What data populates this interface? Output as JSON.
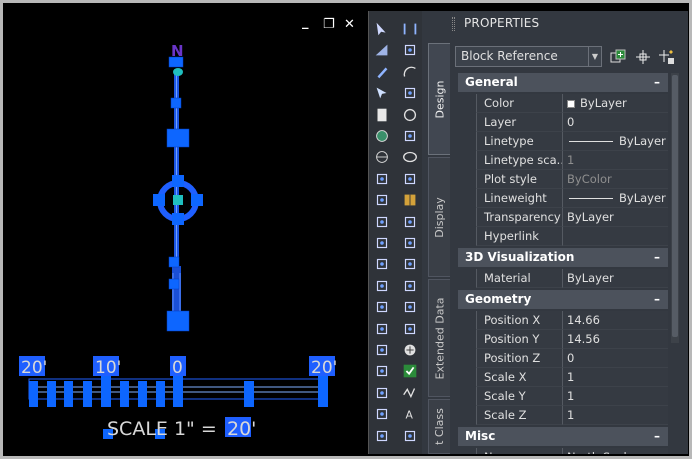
{
  "window": {
    "controls": {
      "minimize": "_",
      "restore": "❐",
      "close": "✕"
    }
  },
  "drawing": {
    "north_label": "N",
    "scale_marks": [
      "20'",
      "10'",
      "0",
      "20'"
    ],
    "scale_text": {
      "label": "SCALE 1\" = ",
      "value": "20'"
    },
    "colors": {
      "entity": "#1f5fff",
      "selection": "#2a7fe0",
      "grip": "#0d66ff",
      "label": "#d8d8d8",
      "teal": "#1fbfbf"
    }
  },
  "toolbar": {
    "column1": [
      "select-arrow-icon",
      "select-window-icon",
      "brush-icon",
      "pointer-icon",
      "page-icon",
      "globe-green-icon",
      "globe-icon",
      "snap-endpoint-icon",
      "snap-midpoint-icon",
      "snap-center-icon",
      "snap-node-icon",
      "snap-quadrant-icon",
      "snap-intersection-icon",
      "snap-extension-icon",
      "snap-insert-icon",
      "snap-perp-icon",
      "snap-tangent-icon",
      "snap-nearest-icon",
      "snap-apparent-icon",
      "snap-parallel-icon"
    ],
    "column2": [
      "line-icon",
      "polyline-icon",
      "arc-icon",
      "rect-icon",
      "circle-icon",
      "arc2-icon",
      "ellipse-icon",
      "hatch-icon",
      "table-icon",
      "dim-linear-icon",
      "dim-aligned-icon",
      "dim-angular-icon",
      "dim-baseline-icon",
      "dim-continue-icon",
      "point-icon",
      "plus-icon",
      "check-icon",
      "wave-icon",
      "text-icon",
      "mtext-icon"
    ]
  },
  "palette": {
    "title": "PROPERTIES",
    "tabs": [
      "Design",
      "Display",
      "Extended Data",
      "t Class"
    ],
    "selector": "Block Reference",
    "quick_icons": [
      "add-selection-icon",
      "select-objects-icon",
      "quick-select-icon"
    ],
    "sections": [
      {
        "title": "General",
        "toggle": "–",
        "rows": [
          {
            "label": "Color",
            "value": "ByLayer",
            "swatch": true
          },
          {
            "label": "Layer",
            "value": "0"
          },
          {
            "label": "Linetype",
            "value": "ByLayer",
            "line": true
          },
          {
            "label": "Linetype sca...",
            "value": "1",
            "dim": true
          },
          {
            "label": "Plot style",
            "value": "ByColor",
            "dim": true
          },
          {
            "label": "Lineweight",
            "value": "ByLayer",
            "line": true
          },
          {
            "label": "Transparency",
            "value": "ByLayer"
          },
          {
            "label": "Hyperlink",
            "value": ""
          }
        ]
      },
      {
        "title": "3D Visualization",
        "toggle": "–",
        "rows": [
          {
            "label": "Material",
            "value": "ByLayer"
          }
        ]
      },
      {
        "title": "Geometry",
        "toggle": "–",
        "rows": [
          {
            "label": "Position X",
            "value": "14.66"
          },
          {
            "label": "Position Y",
            "value": "14.56"
          },
          {
            "label": "Position Z",
            "value": "0"
          },
          {
            "label": "Scale X",
            "value": "1"
          },
          {
            "label": "Scale Y",
            "value": "1"
          },
          {
            "label": "Scale Z",
            "value": "1"
          }
        ]
      },
      {
        "title": "Misc",
        "toggle": "–",
        "rows": [
          {
            "label": "Name",
            "value": "North Scale ..."
          }
        ]
      }
    ]
  }
}
